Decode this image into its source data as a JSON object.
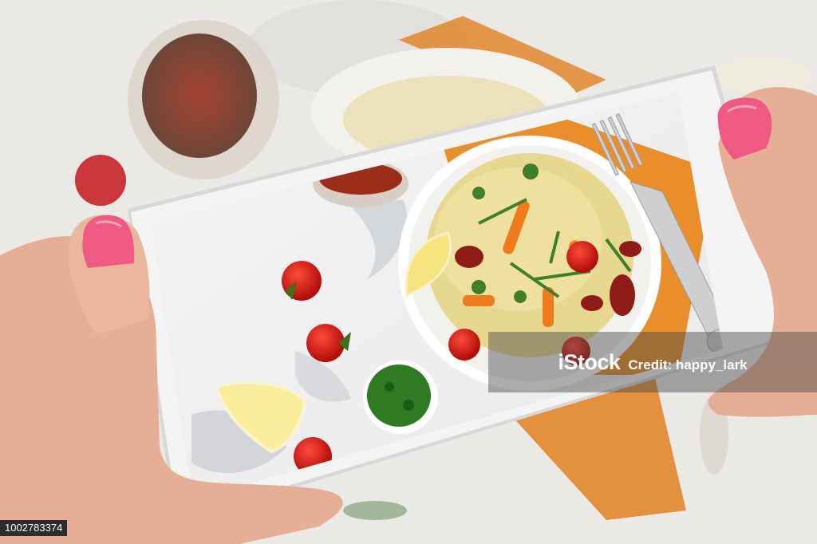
{
  "watermark": {
    "logo_text": "iStock",
    "credit_text": "Credit: happy_lark"
  },
  "image_id": "1002783374",
  "colors": {
    "background": "#e9e7e4",
    "phone_frame": "#f3f3f3",
    "napkin": "#e68b2a",
    "nail_polish": "#f0577e",
    "skin": "#e8b39b"
  }
}
